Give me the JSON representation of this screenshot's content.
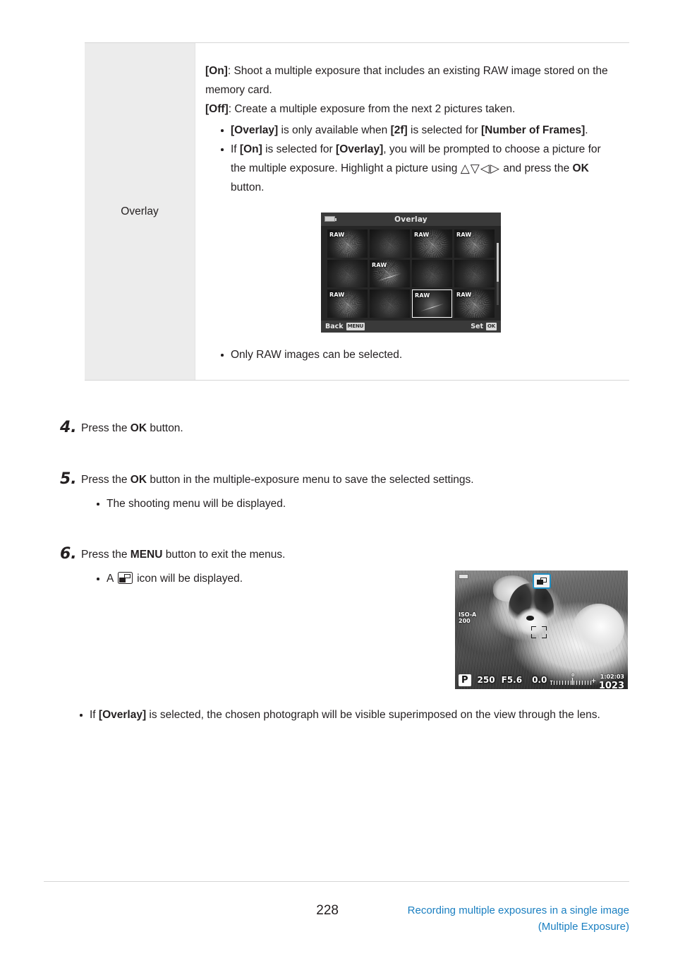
{
  "table": {
    "row_label": "Overlay",
    "paragraphs": [
      {
        "bold_lead": "[On]",
        "rest": ": Shoot a multiple exposure that includes an existing RAW image stored on the memory card."
      },
      {
        "bold_lead": "[Off]",
        "rest": ": Create a multiple exposure from the next 2 pictures taken."
      }
    ],
    "bullets": [
      "[Overlay] is only available when [2f] is selected for [Number of Frames].",
      "If [On] is selected for [Overlay], you will be prompted to choose a picture for the multiple exposure. Highlight a picture using △ ▽ ◁ ▷ and press the OK button."
    ],
    "bullet_after_image": "Only RAW images can be selected."
  },
  "overlay_screen": {
    "title": "Overlay",
    "raw_label": "RAW",
    "back_label": "Back",
    "menu_key": "MENU",
    "set_label": "Set",
    "ok_key": "OK",
    "thumbnails": [
      {
        "raw": true,
        "selected": false
      },
      {
        "raw": false,
        "selected": false
      },
      {
        "raw": true,
        "selected": false
      },
      {
        "raw": true,
        "selected": false
      },
      {
        "raw": false,
        "selected": false
      },
      {
        "raw": true,
        "selected": false
      },
      {
        "raw": false,
        "selected": false
      },
      {
        "raw": false,
        "selected": false
      },
      {
        "raw": true,
        "selected": false
      },
      {
        "raw": false,
        "selected": false
      },
      {
        "raw": true,
        "selected": true
      },
      {
        "raw": true,
        "selected": false
      }
    ]
  },
  "steps": [
    {
      "number": "4.",
      "text_parts": [
        {
          "t": "Press the ",
          "b": false
        },
        {
          "t": "OK",
          "b": true
        },
        {
          "t": " button.",
          "b": false
        }
      ],
      "bullets": []
    },
    {
      "number": "5.",
      "text_parts": [
        {
          "t": "Press the ",
          "b": false
        },
        {
          "t": "OK",
          "b": true
        },
        {
          "t": " button in the multiple-exposure menu to save the selected settings.",
          "b": false
        }
      ],
      "bullets": [
        "The shooting menu will be displayed."
      ]
    },
    {
      "number": "6.",
      "text_parts": [
        {
          "t": "Press the ",
          "b": false
        },
        {
          "t": "MENU",
          "b": true
        },
        {
          "t": " button to exit the menus.",
          "b": false
        }
      ],
      "bullets": []
    }
  ],
  "step6": {
    "bullet_prefix": "A",
    "bullet_suffix": "icon will be displayed.",
    "final_bullet_parts": [
      {
        "t": "If ",
        "b": false
      },
      {
        "t": "[Overlay]",
        "b": true
      },
      {
        "t": " is selected, the chosen photograph will be visible superimposed on the view through the lens.",
        "b": false
      }
    ]
  },
  "liveview": {
    "mode": "P",
    "shutter": "250",
    "aperture": "F5.6",
    "exposure_comp": "0.0",
    "scale_zero": "0",
    "scale_minus": "–",
    "scale_plus": "+",
    "time_remaining": "1:02:03",
    "shots_remaining": "1023",
    "iso_line1": "ISO-A",
    "iso_line2": "200"
  },
  "footer": {
    "page_number": "228",
    "running_title_line1": "Recording multiple exposures in a single image",
    "running_title_line2": "(Multiple Exposure)"
  },
  "colors": {
    "accent_blue": "#1a7fc1",
    "table_label_bg": "#ececec",
    "rule": "#d6d6d6",
    "text": "#231f20"
  }
}
